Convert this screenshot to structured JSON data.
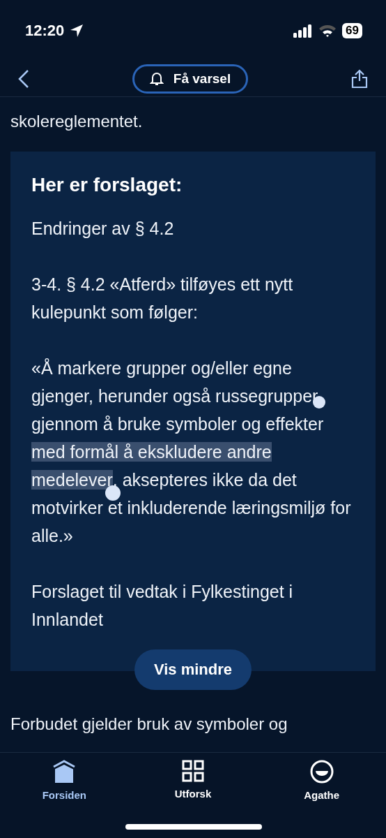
{
  "status_bar": {
    "time": "12:20",
    "battery": "69"
  },
  "header": {
    "alert_button": "Få varsel"
  },
  "intro_text": "skolereglementet.",
  "proposal": {
    "title": "Her er forslaget:",
    "paragraphs": [
      {
        "kind": "plain",
        "text": "Endringer av § 4.2"
      },
      {
        "kind": "plain",
        "text": "3-4. § 4.2 «Atferd» tilføyes ett nytt kulepunkt som følger:"
      },
      {
        "kind": "selection",
        "before": "«Å markere grupper og/eller egne gjenger, herunder også russegrupper, gjennom å bruke symboler og effekter ",
        "selected": "med formål å ekskludere andre medelever",
        "after": ", aksepteres ikke da det motvirker et inkluderende læringsmiljø for alle.»"
      },
      {
        "kind": "plain",
        "text": "Forslaget til vedtak i Fylkestinget i Innlandet"
      }
    ],
    "toggle_button": "Vis mindre"
  },
  "body_text": "Forbudet gjelder bruk av symboler og",
  "tab_bar": [
    {
      "label": "Forsiden",
      "kind": "home",
      "selected": true
    },
    {
      "label": "Utforsk",
      "kind": "explore",
      "selected": false
    },
    {
      "label": "Agathe",
      "kind": "profile",
      "selected": false
    }
  ]
}
